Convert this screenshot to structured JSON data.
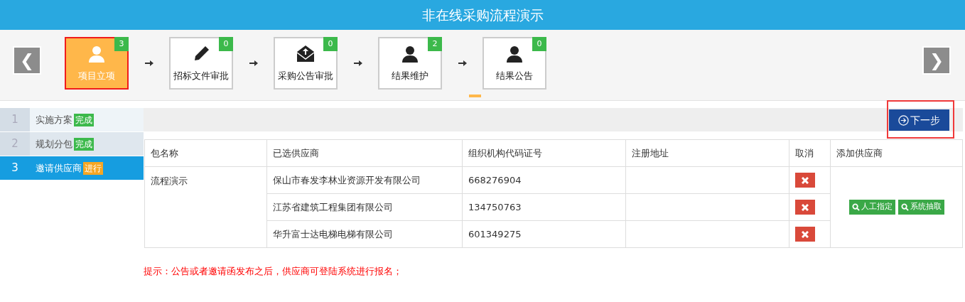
{
  "title": "非在线采购流程演示",
  "nav": {
    "prev": "❮",
    "next": "❯"
  },
  "steps": [
    {
      "label": "项目立项",
      "count": "3",
      "selected": true,
      "kind": "person"
    },
    {
      "label": "招标文件审批",
      "count": "0",
      "selected": false,
      "kind": "pencil"
    },
    {
      "label": "采购公告审批",
      "count": "0",
      "selected": false,
      "kind": "envelope"
    },
    {
      "label": "结果维护",
      "count": "2",
      "selected": false,
      "kind": "person"
    },
    {
      "label": "结果公告",
      "count": "0",
      "selected": false,
      "kind": "person"
    }
  ],
  "substeps": [
    {
      "number": "1",
      "label": "实施方案",
      "status": "完成",
      "kind": "done",
      "selected": false
    },
    {
      "number": "2",
      "label": "规划分包",
      "status": "完成",
      "kind": "done",
      "selected": false
    },
    {
      "number": "3",
      "label": "邀请供应商",
      "status": "进行",
      "kind": "active",
      "selected": true
    }
  ],
  "next_button": {
    "label": "下一步",
    "highlighted": true
  },
  "table": {
    "columns": [
      "包名称",
      "已选供应商",
      "组织机构代码证号",
      "注册地址",
      "取消",
      "添加供应商"
    ],
    "package": "流程演示",
    "rows": [
      {
        "supplier": "保山市春发李林业资源开发有限公司",
        "code": "668276904"
      },
      {
        "supplier": "江苏省建筑工程集团有限公司",
        "code": "134750763"
      },
      {
        "supplier": "华升富士达电梯电梯有限公司",
        "code": "601349275"
      }
    ],
    "add_buttons": [
      "人工指定",
      "系统抽取"
    ]
  },
  "tip": "提示：公告或者邀请函发布之后，供应商可登陆系统进行报名；"
}
